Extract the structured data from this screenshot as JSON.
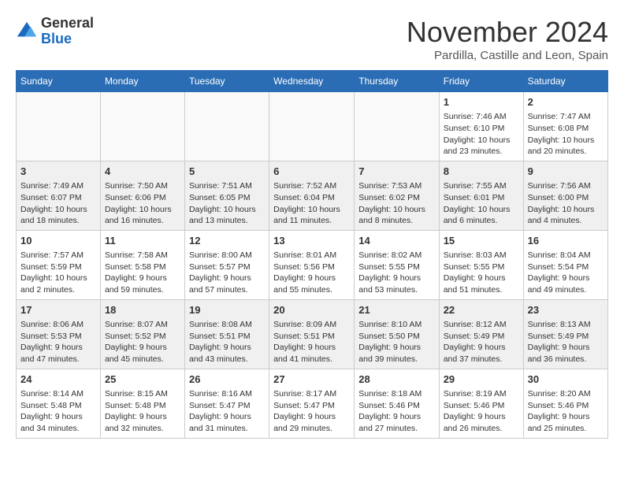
{
  "header": {
    "logo_line1": "General",
    "logo_line2": "Blue",
    "month": "November 2024",
    "location": "Pardilla, Castille and Leon, Spain"
  },
  "weekdays": [
    "Sunday",
    "Monday",
    "Tuesday",
    "Wednesday",
    "Thursday",
    "Friday",
    "Saturday"
  ],
  "weeks": [
    [
      {
        "day": "",
        "text": ""
      },
      {
        "day": "",
        "text": ""
      },
      {
        "day": "",
        "text": ""
      },
      {
        "day": "",
        "text": ""
      },
      {
        "day": "",
        "text": ""
      },
      {
        "day": "1",
        "text": "Sunrise: 7:46 AM\nSunset: 6:10 PM\nDaylight: 10 hours and 23 minutes."
      },
      {
        "day": "2",
        "text": "Sunrise: 7:47 AM\nSunset: 6:08 PM\nDaylight: 10 hours and 20 minutes."
      }
    ],
    [
      {
        "day": "3",
        "text": "Sunrise: 7:49 AM\nSunset: 6:07 PM\nDaylight: 10 hours and 18 minutes."
      },
      {
        "day": "4",
        "text": "Sunrise: 7:50 AM\nSunset: 6:06 PM\nDaylight: 10 hours and 16 minutes."
      },
      {
        "day": "5",
        "text": "Sunrise: 7:51 AM\nSunset: 6:05 PM\nDaylight: 10 hours and 13 minutes."
      },
      {
        "day": "6",
        "text": "Sunrise: 7:52 AM\nSunset: 6:04 PM\nDaylight: 10 hours and 11 minutes."
      },
      {
        "day": "7",
        "text": "Sunrise: 7:53 AM\nSunset: 6:02 PM\nDaylight: 10 hours and 8 minutes."
      },
      {
        "day": "8",
        "text": "Sunrise: 7:55 AM\nSunset: 6:01 PM\nDaylight: 10 hours and 6 minutes."
      },
      {
        "day": "9",
        "text": "Sunrise: 7:56 AM\nSunset: 6:00 PM\nDaylight: 10 hours and 4 minutes."
      }
    ],
    [
      {
        "day": "10",
        "text": "Sunrise: 7:57 AM\nSunset: 5:59 PM\nDaylight: 10 hours and 2 minutes."
      },
      {
        "day": "11",
        "text": "Sunrise: 7:58 AM\nSunset: 5:58 PM\nDaylight: 9 hours and 59 minutes."
      },
      {
        "day": "12",
        "text": "Sunrise: 8:00 AM\nSunset: 5:57 PM\nDaylight: 9 hours and 57 minutes."
      },
      {
        "day": "13",
        "text": "Sunrise: 8:01 AM\nSunset: 5:56 PM\nDaylight: 9 hours and 55 minutes."
      },
      {
        "day": "14",
        "text": "Sunrise: 8:02 AM\nSunset: 5:55 PM\nDaylight: 9 hours and 53 minutes."
      },
      {
        "day": "15",
        "text": "Sunrise: 8:03 AM\nSunset: 5:55 PM\nDaylight: 9 hours and 51 minutes."
      },
      {
        "day": "16",
        "text": "Sunrise: 8:04 AM\nSunset: 5:54 PM\nDaylight: 9 hours and 49 minutes."
      }
    ],
    [
      {
        "day": "17",
        "text": "Sunrise: 8:06 AM\nSunset: 5:53 PM\nDaylight: 9 hours and 47 minutes."
      },
      {
        "day": "18",
        "text": "Sunrise: 8:07 AM\nSunset: 5:52 PM\nDaylight: 9 hours and 45 minutes."
      },
      {
        "day": "19",
        "text": "Sunrise: 8:08 AM\nSunset: 5:51 PM\nDaylight: 9 hours and 43 minutes."
      },
      {
        "day": "20",
        "text": "Sunrise: 8:09 AM\nSunset: 5:51 PM\nDaylight: 9 hours and 41 minutes."
      },
      {
        "day": "21",
        "text": "Sunrise: 8:10 AM\nSunset: 5:50 PM\nDaylight: 9 hours and 39 minutes."
      },
      {
        "day": "22",
        "text": "Sunrise: 8:12 AM\nSunset: 5:49 PM\nDaylight: 9 hours and 37 minutes."
      },
      {
        "day": "23",
        "text": "Sunrise: 8:13 AM\nSunset: 5:49 PM\nDaylight: 9 hours and 36 minutes."
      }
    ],
    [
      {
        "day": "24",
        "text": "Sunrise: 8:14 AM\nSunset: 5:48 PM\nDaylight: 9 hours and 34 minutes."
      },
      {
        "day": "25",
        "text": "Sunrise: 8:15 AM\nSunset: 5:48 PM\nDaylight: 9 hours and 32 minutes."
      },
      {
        "day": "26",
        "text": "Sunrise: 8:16 AM\nSunset: 5:47 PM\nDaylight: 9 hours and 31 minutes."
      },
      {
        "day": "27",
        "text": "Sunrise: 8:17 AM\nSunset: 5:47 PM\nDaylight: 9 hours and 29 minutes."
      },
      {
        "day": "28",
        "text": "Sunrise: 8:18 AM\nSunset: 5:46 PM\nDaylight: 9 hours and 27 minutes."
      },
      {
        "day": "29",
        "text": "Sunrise: 8:19 AM\nSunset: 5:46 PM\nDaylight: 9 hours and 26 minutes."
      },
      {
        "day": "30",
        "text": "Sunrise: 8:20 AM\nSunset: 5:46 PM\nDaylight: 9 hours and 25 minutes."
      }
    ]
  ]
}
